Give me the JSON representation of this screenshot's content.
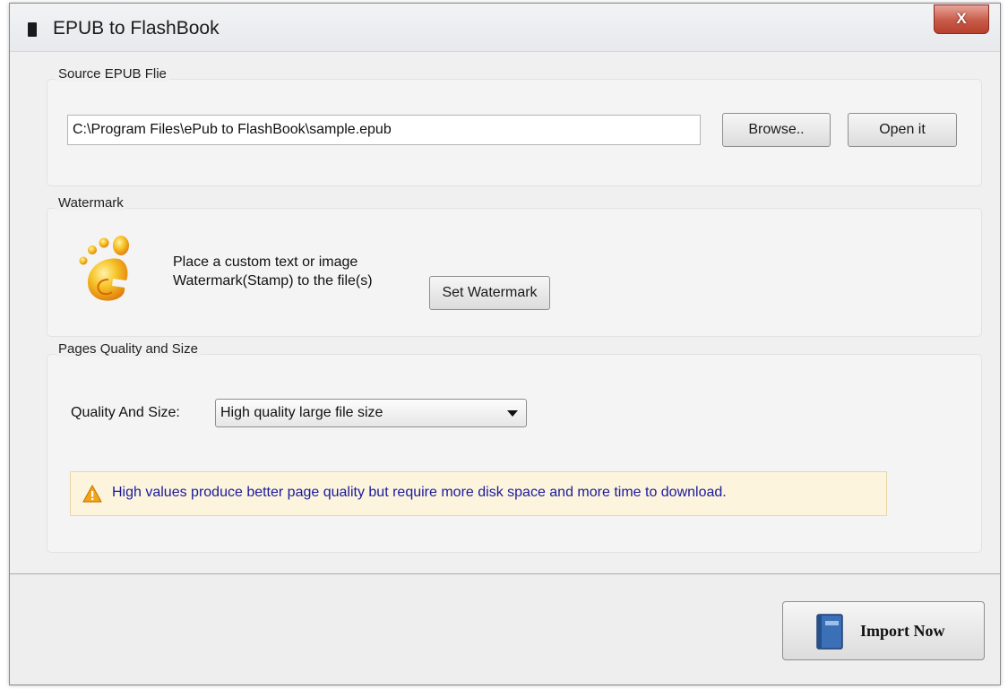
{
  "window": {
    "title": "EPUB to FlashBook",
    "close_label": "X"
  },
  "source": {
    "group_title": "Source EPUB Flie",
    "path_value": "C:\\Program Files\\ePub to FlashBook\\sample.epub",
    "browse_label": "Browse..",
    "open_label": "Open it"
  },
  "watermark": {
    "group_title": "Watermark",
    "desc_line1": "Place a custom text or image",
    "desc_line2": "Watermark(Stamp) to the file(s)",
    "button_label": "Set Watermark"
  },
  "quality": {
    "group_title": "Pages Quality and Size",
    "label": "Quality And Size:",
    "selected": "High quality large file size",
    "warning": "High values produce better page quality but require more disk space and more time to download.",
    "warning_color": "#1a1aa0"
  },
  "footer": {
    "import_label": "Import Now"
  }
}
